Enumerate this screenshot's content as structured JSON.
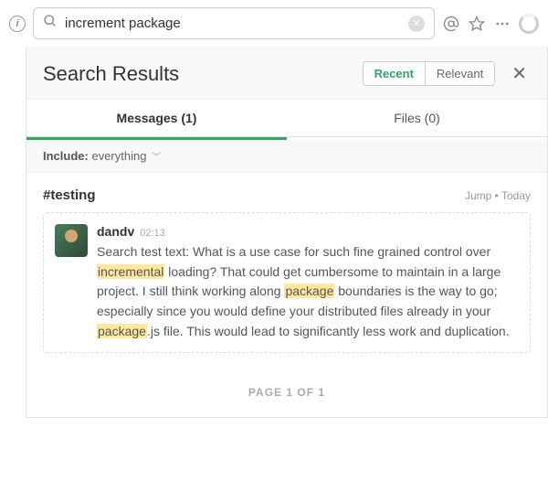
{
  "search": {
    "value": "increment package"
  },
  "header": {
    "title": "Search Results",
    "toggle": {
      "recent": "Recent",
      "relevant": "Relevant"
    }
  },
  "tabs": {
    "messages": "Messages (1)",
    "files": "Files (0)"
  },
  "filter": {
    "label": "Include:",
    "value": "everything"
  },
  "result": {
    "channel": "#testing",
    "jump": "Jump",
    "date": "Today",
    "user": "dandv",
    "time": "02:13",
    "text_pre1": "Search test text: What is a use case for such fine grained control over ",
    "hl1": "incremental",
    "text_mid1": " loading? That could get cumbersome to maintain in a large project. I still think working along ",
    "hl2": "package",
    "text_mid2": " boundaries is the way to go; especially since you would define your distributed files already in your ",
    "hl3": "package",
    "text_post": ".js file. This would lead to significantly less work and duplication."
  },
  "pagination": "PAGE 1 OF 1"
}
